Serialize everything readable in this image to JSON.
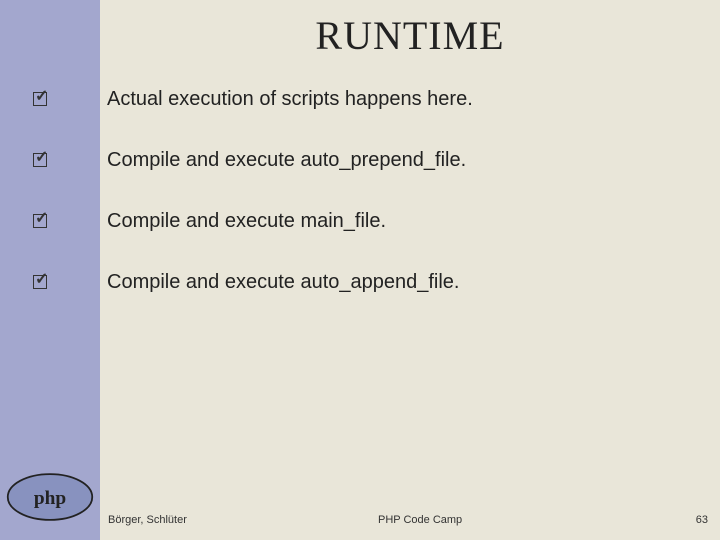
{
  "title": "RUNTIME",
  "bullets": [
    "Actual execution of scripts happens here.",
    "Compile and execute auto_prepend_file.",
    "Compile and execute main_file.",
    "Compile and execute auto_append_file."
  ],
  "footer": {
    "authors": "Börger, Schlüter",
    "event": "PHP Code Camp",
    "page": "63"
  },
  "logo_label": "php"
}
